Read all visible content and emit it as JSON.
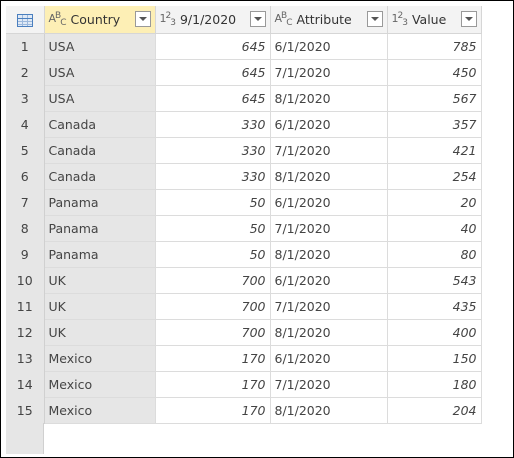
{
  "columns": [
    {
      "type": "ABC",
      "name": "Country"
    },
    {
      "type": "123",
      "name": "9/1/2020"
    },
    {
      "type": "ABC",
      "name": "Attribute"
    },
    {
      "type": "123",
      "name": "Value"
    }
  ],
  "rows": [
    [
      "1",
      "USA",
      "645",
      "6/1/2020",
      "785"
    ],
    [
      "2",
      "USA",
      "645",
      "7/1/2020",
      "450"
    ],
    [
      "3",
      "USA",
      "645",
      "8/1/2020",
      "567"
    ],
    [
      "4",
      "Canada",
      "330",
      "6/1/2020",
      "357"
    ],
    [
      "5",
      "Canada",
      "330",
      "7/1/2020",
      "421"
    ],
    [
      "6",
      "Canada",
      "330",
      "8/1/2020",
      "254"
    ],
    [
      "7",
      "Panama",
      "50",
      "6/1/2020",
      "20"
    ],
    [
      "8",
      "Panama",
      "50",
      "7/1/2020",
      "40"
    ],
    [
      "9",
      "Panama",
      "50",
      "8/1/2020",
      "80"
    ],
    [
      "10",
      "UK",
      "700",
      "6/1/2020",
      "543"
    ],
    [
      "11",
      "UK",
      "700",
      "7/1/2020",
      "435"
    ],
    [
      "12",
      "UK",
      "700",
      "8/1/2020",
      "400"
    ],
    [
      "13",
      "Mexico",
      "170",
      "6/1/2020",
      "150"
    ],
    [
      "14",
      "Mexico",
      "170",
      "7/1/2020",
      "180"
    ],
    [
      "15",
      "Mexico",
      "170",
      "8/1/2020",
      "204"
    ]
  ]
}
